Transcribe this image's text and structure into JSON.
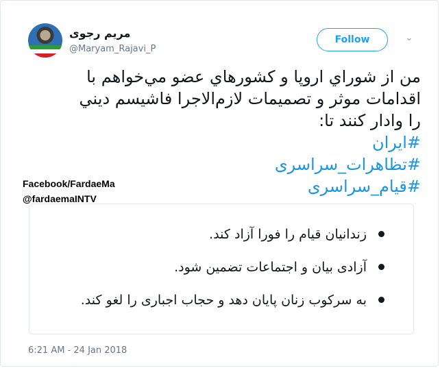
{
  "author": {
    "display_name": "مریم رجوی",
    "handle": "@Maryam_Rajavi_P"
  },
  "header": {
    "follow_label": "Follow",
    "menu_icon": "chevron-down-icon"
  },
  "tweet": {
    "line1": "من از شوراي اروپا و كشورهاي عضو مي‌خواهم با",
    "line2": "اقدامات موثر و تصميمات لازم‌الاجرا فاشيسم ديني",
    "line3": "را وادار كنند تا:",
    "hashtags": [
      "#ایران",
      "#تظاهرات_سراسری",
      "#قیام_سراسری"
    ]
  },
  "watermark": {
    "line1": "Facebook/FardaeMa",
    "line2": "@fardaemaINTV"
  },
  "card": {
    "items": [
      "زندانیان قیام را فورا آزاد کند.",
      "آزادی بیان و اجتماعات تضمین شود.",
      "به سرکوب زنان پایان دهد و حجاب اجباری را لغو کند."
    ]
  },
  "timestamp": "6:21 AM - 24 Jan 2018",
  "colors": {
    "accent": "#1da1f2",
    "hashtag": "#1b95e0",
    "text": "#14171a",
    "muted": "#657786"
  }
}
